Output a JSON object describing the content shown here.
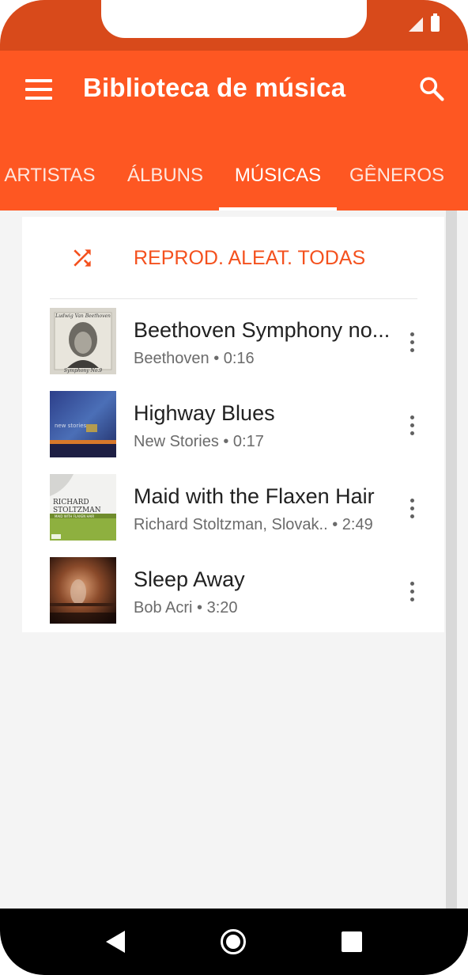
{
  "app": {
    "title": "Biblioteca de música",
    "accent_color": "#fe5722",
    "status_bar_color": "#d84a1b"
  },
  "toolbar": {
    "menu_icon": "hamburger-menu-icon",
    "search_icon": "search-icon"
  },
  "tabs": [
    {
      "label": "ARTISTAS",
      "selected": false
    },
    {
      "label": "ÁLBUNS",
      "selected": false
    },
    {
      "label": "MÚSICAS",
      "selected": true
    },
    {
      "label": "GÊNEROS",
      "selected": false
    }
  ],
  "shuffle": {
    "label": "REPROD. ALEAT. TODAS",
    "icon": "shuffle-icon"
  },
  "songs": [
    {
      "title": "Beethoven Symphony no...",
      "subtitle": "Beethoven • 0:16",
      "art": "beethoven-album-art"
    },
    {
      "title": "Highway Blues",
      "subtitle": "New Stories • 0:17",
      "art": "new-stories-album-art"
    },
    {
      "title": "Maid with the Flaxen Hair",
      "subtitle": "Richard Stoltzman, Slovak..  • 2:49",
      "art": "richard-stoltzman-album-art"
    },
    {
      "title": "Sleep Away",
      "subtitle": "Bob Acri • 3:20",
      "art": "bob-acri-album-art"
    }
  ],
  "album_art_text": {
    "beethoven_top": "Ludwig Van Beethoven",
    "beethoven_bottom": "Symphony No.9",
    "new_stories": "new stories",
    "stoltzman_top": "RICHARD",
    "stoltzman_bottom": "STOLTZMAN",
    "stoltzman_sub": "MAID WITH FLAXEN HAIR"
  },
  "nav": {
    "back_icon": "back-triangle-icon",
    "home_icon": "home-circle-icon",
    "recents_icon": "recents-square-icon"
  }
}
